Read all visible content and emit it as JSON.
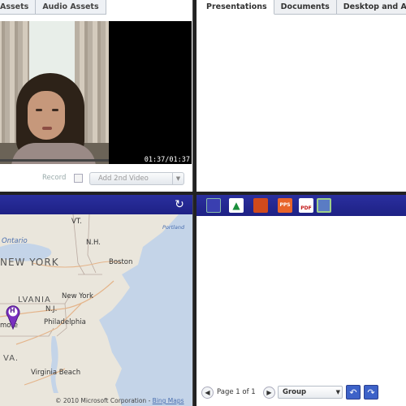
{
  "media_panel": {
    "tabs": [
      {
        "label": "Assets"
      },
      {
        "label": "Audio Assets"
      }
    ],
    "video": {
      "timecode": "01:37/01:37"
    },
    "record_label": "Record",
    "add_video_label": "Add 2nd Video"
  },
  "docs_panel": {
    "tabs": [
      {
        "label": "Presentations"
      },
      {
        "label": "Documents"
      },
      {
        "label": "Desktop and Ap"
      }
    ]
  },
  "map_panel": {
    "labels": {
      "vt": "VT.",
      "nh": "N.H.",
      "ontario": "Ontario",
      "new_york_state": "NEW YORK",
      "boston": "Boston",
      "new_york_city": "New York",
      "pa": "LVANIA",
      "nj": "N.J.",
      "philadelphia": "Philadelphia",
      "baltimore": "more",
      "va": "VA.",
      "virginia_beach": "Virginia Beach",
      "portland": "Portland"
    },
    "pin_letter": "H",
    "copyright": "© 2010 Microsoft Corporation",
    "map_link": "Bing Maps"
  },
  "whiteboard_panel": {
    "tools": [
      {
        "icon": "slide-icon"
      },
      {
        "icon": "acrobat-icon"
      },
      {
        "icon": "powerpoint-icon"
      },
      {
        "icon": "ppt-file-icon"
      },
      {
        "icon": "pdf-file-icon"
      },
      {
        "icon": "screen-share-icon"
      }
    ],
    "tool_text": {
      "ppt": "PPS",
      "pdf": "PDF"
    },
    "pager": {
      "text": "Page 1 of 1",
      "group_label": "Group"
    }
  },
  "colors": {
    "bar_blue": "#1e2185",
    "tab_bg": "#eef1f5",
    "map_water": "#c4d4e8"
  }
}
